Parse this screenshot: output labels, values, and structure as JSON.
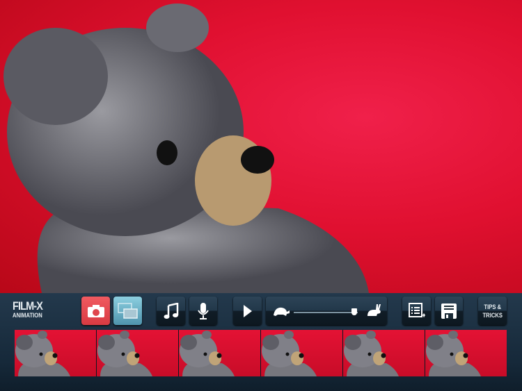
{
  "app": {
    "logo_line1": "FILM-X",
    "logo_line2": "ANIMATION"
  },
  "toolbar": {
    "camera": "camera-icon",
    "overlay": "onion-skin-icon",
    "music": "music-icon",
    "mic": "microphone-icon",
    "play": "play-icon",
    "speed": {
      "min_icon": "turtle-icon",
      "max_icon": "rabbit-icon",
      "value": 0.95
    },
    "add_list": "list-add-icon",
    "save": "save-icon",
    "tips_line1": "TIPS &",
    "tips_line2": "TRICKS"
  },
  "colors": {
    "camera": "#e0454c",
    "overlay": "#6cb4cc",
    "toolbar": "#1e3345",
    "background": "#e01030"
  },
  "frames": {
    "count": 6
  }
}
